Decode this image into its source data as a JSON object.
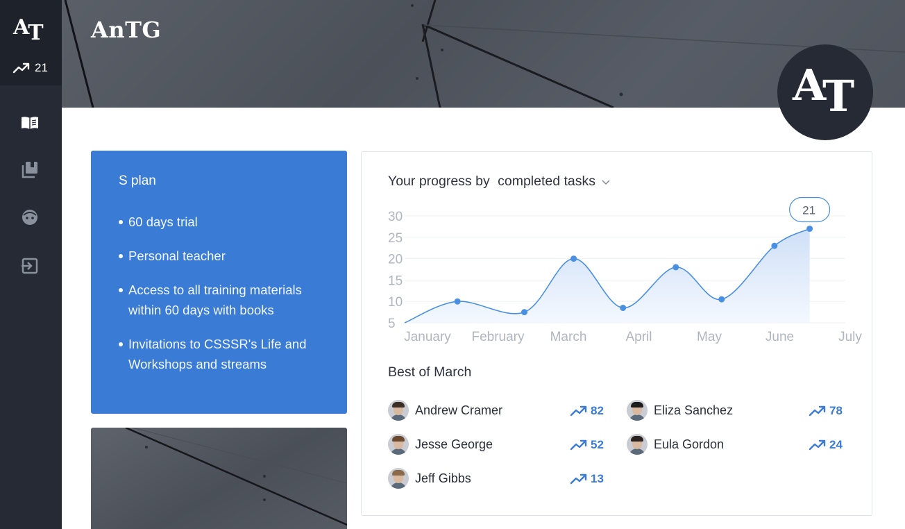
{
  "sidebar": {
    "logo": {
      "a": "A",
      "t": "T"
    },
    "trend_value": "21",
    "nav": [
      {
        "icon": "book-open-icon",
        "active": true
      },
      {
        "icon": "library-icon",
        "active": false
      },
      {
        "icon": "face-icon",
        "active": false
      },
      {
        "icon": "logout-icon",
        "active": false
      }
    ]
  },
  "header": {
    "brand": "AnTG",
    "logo": {
      "a": "A",
      "t": "T"
    }
  },
  "plan": {
    "title": "S plan",
    "items": [
      "60 days trial",
      "Personal teacher",
      "Access to all training materials within 60 days with books",
      "Invitations to CSSSR's Life and Workshops and streams"
    ]
  },
  "progress": {
    "title": "Your progress by",
    "selector": "completed tasks",
    "best_title": "Best of March",
    "leaders": [
      {
        "name": "Andrew Cramer",
        "score": "82"
      },
      {
        "name": "Eliza Sanchez",
        "score": "78"
      },
      {
        "name": "Jesse George",
        "score": "52"
      },
      {
        "name": "Eula Gordon",
        "score": "24"
      },
      {
        "name": "Jeff Gibbs",
        "score": "13"
      }
    ]
  },
  "colors": {
    "accent": "#3a7bd5",
    "sidebar": "#252a35",
    "line": "#4a90e2"
  },
  "chart_data": {
    "type": "area",
    "x": [
      0.0,
      0.75,
      1.7,
      2.4,
      3.1,
      3.85,
      4.5,
      5.25,
      5.75
    ],
    "x_unit": "months since January",
    "categories": [
      "January",
      "February",
      "March",
      "April",
      "May",
      "June",
      "July"
    ],
    "values": [
      5,
      10,
      7.5,
      20,
      8.5,
      18,
      10.5,
      23,
      27
    ],
    "ylim": [
      5,
      30
    ],
    "yticks": [
      5,
      10,
      15,
      20,
      25,
      30
    ],
    "callout": "21",
    "grid": true
  }
}
